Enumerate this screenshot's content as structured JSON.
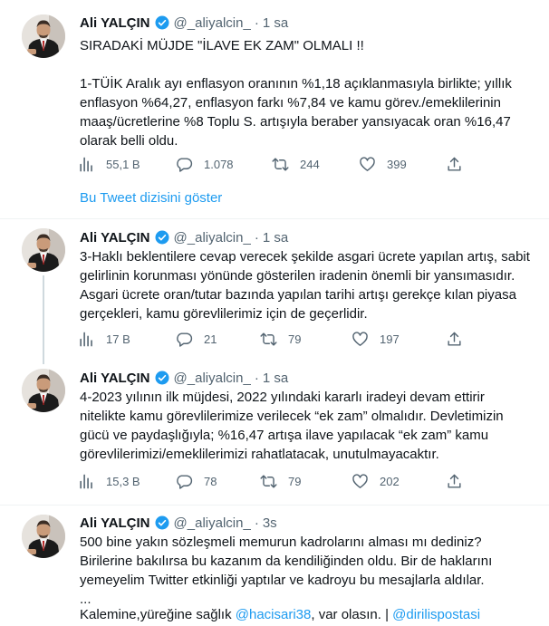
{
  "colors": {
    "accent": "#1d9bf0",
    "muted": "#536471",
    "text": "#0f1419",
    "verified": "#1d9bf0"
  },
  "tweets": [
    {
      "name": "Ali YALÇIN",
      "handle": "@_aliyalcin_",
      "sep": "·",
      "time": "1 sa",
      "headline": "SIRADAKİ MÜJDE \"İLAVE EK ZAM\" OLMALI !!",
      "text": "1-TÜİK Aralık ayı enflasyon oranının %1,18 açıklanmasıyla birlikte; yıllık enflasyon %64,27, enflasyon farkı %7,84 ve kamu görev./emeklilerinin maaş/ücretlerine %8 Toplu S. artışıyla beraber yansıyacak oran %16,47 olarak belli oldu.",
      "views": "55,1 B",
      "replies": "1.078",
      "retweets": "244",
      "likes": "399"
    },
    {
      "name": "Ali YALÇIN",
      "handle": "@_aliyalcin_",
      "sep": "·",
      "time": "1 sa",
      "text": "3-Haklı beklentilere cevap verecek şekilde asgari ücrete yapılan artış, sabit gelirlinin korunması yönünde gösterilen iradenin önemli bir yansımasıdır. Asgari ücrete oran/tutar bazında yapılan tarihi artışı gerekçe kılan piyasa gerçekleri, kamu görevlilerimiz için de geçerlidir.",
      "views": "17 B",
      "replies": "21",
      "retweets": "79",
      "likes": "197"
    },
    {
      "name": "Ali YALÇIN",
      "handle": "@_aliyalcin_",
      "sep": "·",
      "time": "1 sa",
      "text": "4-2023 yılının ilk müjdesi, 2022 yılındaki kararlı iradeyi devam ettirir nitelikte kamu görevlilerimize verilecek “ek zam” olmalıdır. Devletimizin gücü ve paydaşlığıyla; %16,47 artışa ilave yapılacak “ek zam” kamu görevlilerimizi/emeklilerimizi rahatlatacak, unutulmayacaktır.",
      "views": "15,3 B",
      "replies": "78",
      "retweets": "79",
      "likes": "202"
    },
    {
      "name": "Ali YALÇIN",
      "handle": "@_aliyalcin_",
      "sep": "·",
      "time": "3s",
      "text": "500 bine yakın sözleşmeli memurun kadrolarını alması mı dediniz?  Birilerine bakılırsa bu kazanım da kendiliğinden oldu. Bir de haklarını yemeyelim Twitter etkinliği yaptılar ve kadroyu bu mesajlarla aldılar.",
      "ellipsis": "...",
      "closing_prefix": "Kalemine,yüreğine sağlık ",
      "mention1": "@hacisari38",
      "closing_mid": ", var olasın. | ",
      "mention2": "@dirilispostasi"
    }
  ],
  "show_thread": "Bu Tweet dizisini göster",
  "icons": {
    "views": "bar-chart-icon",
    "reply": "reply-bubble-icon",
    "retweet": "retweet-icon",
    "like": "heart-icon",
    "share": "share-upload-icon",
    "verified": "verified-badge-icon"
  }
}
